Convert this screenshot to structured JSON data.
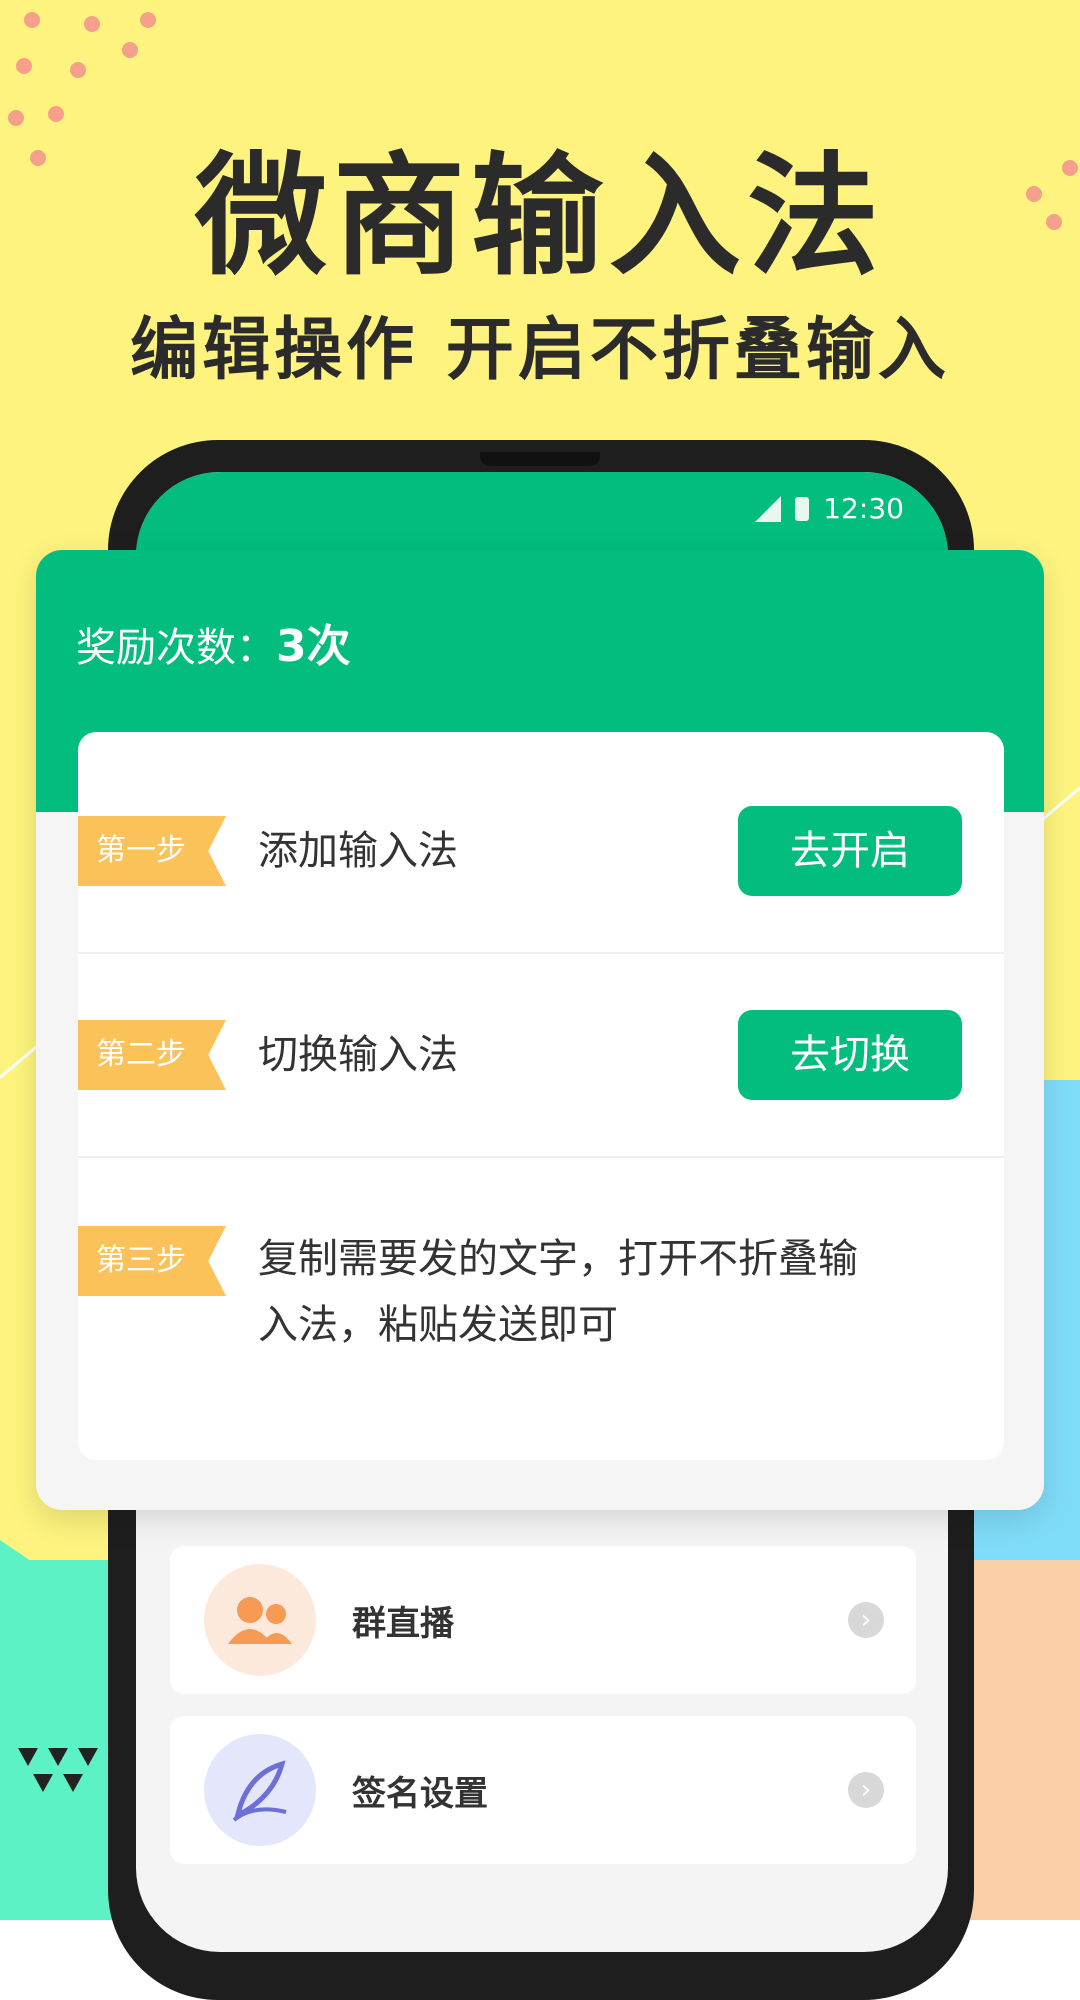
{
  "hero": {
    "title": "微商输入法",
    "subtitle": "编辑操作  开启不折叠输入"
  },
  "status_bar": {
    "time": "12:30"
  },
  "reward": {
    "label": "奖励次数：",
    "value": "3次"
  },
  "steps": [
    {
      "tag": "第一步",
      "text": "添加输入法",
      "button": "去开启"
    },
    {
      "tag": "第二步",
      "text": "切换输入法",
      "button": "去切换"
    },
    {
      "tag": "第三步",
      "text_line1": "复制需要发的文字，打开不折叠输",
      "text_line2": "入法，粘贴发送即可"
    }
  ],
  "menu": [
    {
      "label": "群直播",
      "icon": "group-icon"
    },
    {
      "label": "签名设置",
      "icon": "quill-icon"
    }
  ],
  "colors": {
    "accent": "#03bd7f",
    "tag": "#fbc25a",
    "background": "#fdf37e"
  }
}
